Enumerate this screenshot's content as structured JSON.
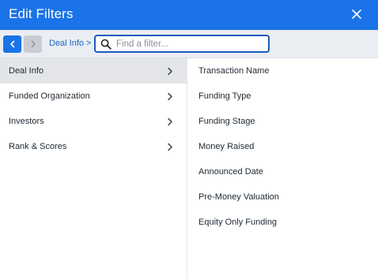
{
  "header": {
    "title": "Edit Filters",
    "close_icon": "close-icon"
  },
  "toolbar": {
    "back_icon": "chevron-left-icon",
    "forward_icon": "chevron-right-icon",
    "breadcrumb": {
      "current": "Deal Info",
      "separator": ">"
    },
    "search": {
      "placeholder": "Find a filter...",
      "value": "",
      "icon": "search-icon"
    }
  },
  "categories": [
    {
      "label": "Deal Info",
      "active": true
    },
    {
      "label": "Funded Organization",
      "active": false
    },
    {
      "label": "Investors",
      "active": false
    },
    {
      "label": "Rank & Scores",
      "active": false
    }
  ],
  "filters": [
    {
      "label": "Transaction Name"
    },
    {
      "label": "Funding Type"
    },
    {
      "label": "Funding Stage"
    },
    {
      "label": "Money Raised"
    },
    {
      "label": "Announced Date"
    },
    {
      "label": "Pre-Money Valuation"
    },
    {
      "label": "Equity Only Funding"
    }
  ],
  "colors": {
    "header_bg": "#1a73e8",
    "toolbar_bg": "#eaeef3",
    "active_item_bg": "#e3e5e8",
    "link": "#1a65c9"
  }
}
